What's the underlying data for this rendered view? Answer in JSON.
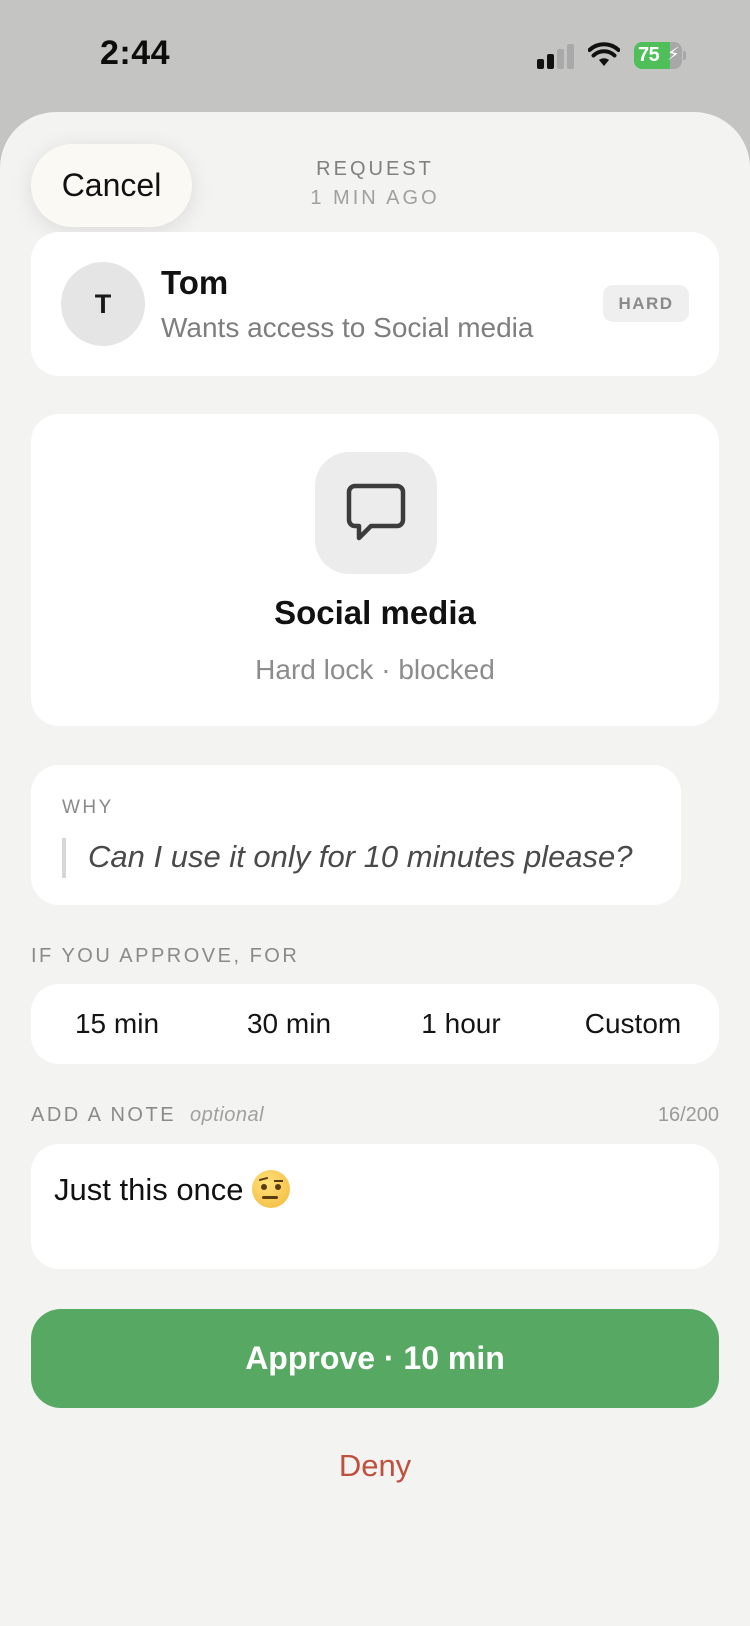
{
  "status_bar": {
    "time": "2:44",
    "battery_level": "75",
    "battery_percent": 75,
    "battery_color": "#4fbf59"
  },
  "header": {
    "cancel_label": "Cancel",
    "title": "REQUEST",
    "subtitle": "1 MIN AGO"
  },
  "requester": {
    "initial": "T",
    "name": "Tom",
    "description": "Wants access to Social media",
    "badge": "HARD"
  },
  "app": {
    "icon": "speech-bubble-icon",
    "name": "Social media",
    "status": "Hard lock · blocked"
  },
  "why": {
    "label": "WHY",
    "text": "Can I use it only for 10 minutes please?"
  },
  "duration": {
    "label": "IF YOU APPROVE, FOR",
    "options": [
      "15 min",
      "30 min",
      "1 hour",
      "Custom"
    ]
  },
  "note": {
    "label": "ADD A NOTE",
    "optional_label": "optional",
    "count": "16/200",
    "text": "Just this once",
    "emoji": "face-with-raised-eyebrow"
  },
  "actions": {
    "approve_label": "Approve · 10 min",
    "approve_color": "#57a862",
    "deny_label": "Deny",
    "deny_color": "#c0503e"
  }
}
